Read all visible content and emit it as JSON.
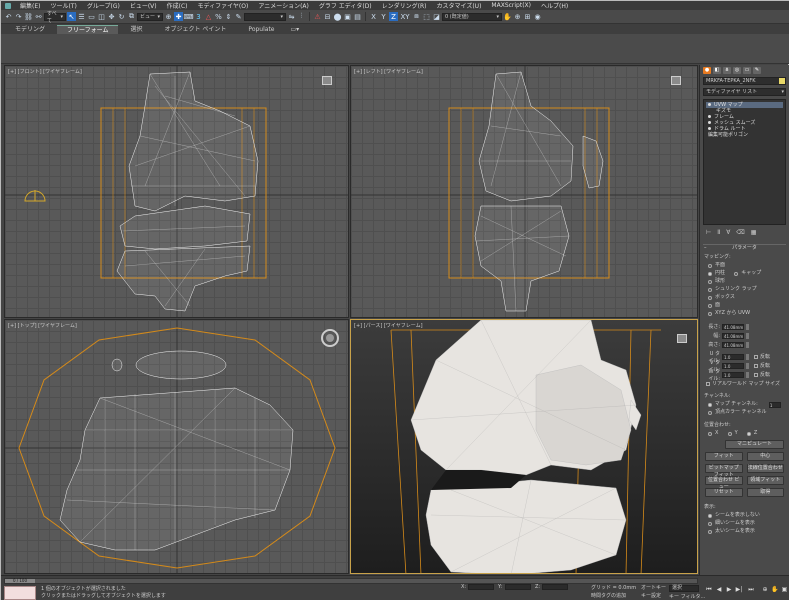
{
  "menu": [
    "編集(E)",
    "ツール(T)",
    "グループ(G)",
    "ビュー(V)",
    "作成(C)",
    "モディファイヤ(O)",
    "アニメーション(A)",
    "グラフ エディタ(D)",
    "レンダリング(R)",
    "カスタマイズ(U)",
    "MAXScript(X)",
    "ヘルプ(H)"
  ],
  "toolbar": {
    "selection_filter": "すべて",
    "ref_coord": "ビュー",
    "named_selection": "",
    "snap_percent": "",
    "axis_x": "X",
    "axis_y": "Y",
    "axis_z": "Z",
    "axis_xy": "XY",
    "layer_select": "0 (既定値)"
  },
  "ribbon": {
    "tabs": [
      "モデリング",
      "フリーフォーム",
      "選択",
      "オブジェクト ペイント",
      "Populate"
    ],
    "active_tab": "フリーフォーム"
  },
  "viewports": {
    "front_label": "[+] [フロント] [ワイヤフレーム]",
    "left_label": "[+] [レフト] [ワイヤフレーム]",
    "top_label": "[+] [トップ] [ワイヤフレーム]",
    "persp_label": "[+] [パース] [ワイヤフレーム]"
  },
  "command_panel": {
    "object_name": "MRKFA-TEPKA_2NFK",
    "modifier_list": "モディファイヤ リスト",
    "stack": [
      "UVW マップ",
      "ギズモ",
      "フレーム",
      "メッシュ スムーズ",
      "ドラム ルート",
      "編集可能ポリゴン"
    ],
    "rollout_title": "パラメータ",
    "mapping_label": "マッピング:",
    "mapping_options": [
      "平面",
      "円柱",
      "球形",
      "シュリンク ラップ",
      "ボックス",
      "面",
      "XYZ から UVW"
    ],
    "cap_label": "キャップ",
    "fields": [
      {
        "label": "長さ:",
        "value": "41.08mm"
      },
      {
        "label": "幅:",
        "value": "41.08mm"
      },
      {
        "label": "高さ:",
        "value": "41.08mm"
      },
      {
        "label": "U タイル:",
        "value": "1.0",
        "flip": "反転"
      },
      {
        "label": "V タイル:",
        "value": "1.0",
        "flip": "反転"
      },
      {
        "label": "W タイル:",
        "value": "1.0",
        "flip": "反転"
      }
    ],
    "real_world_map": "リアルワールド マップ サイズ",
    "channel_label": "チャンネル:",
    "map_channel": "マップ チャンネル:",
    "map_channel_value": "1",
    "vertex_color_channel": "頂点カラー チャンネル",
    "alignment_label": "位置合わせ:",
    "align_axes": [
      "X",
      "Y",
      "Z"
    ],
    "manipulate_btn": "マニピュレート",
    "buttons": [
      [
        "フィット",
        "中心"
      ],
      [
        "ビットマップ フィット",
        "法線位置合わせ"
      ],
      [
        "位置合わせ ビュー",
        "領域フィット"
      ],
      [
        "リセット",
        "取得"
      ]
    ],
    "display_label": "表示:",
    "display_options": [
      "シームを表示しない",
      "細いシームを表示",
      "太いシームを表示"
    ]
  },
  "status": {
    "frame": "0 / 100",
    "msg1": "1 個のオブジェクトが選択されました",
    "msg2": "クリックまたはドラッグしてオブジェクトを選択します",
    "x_label": "X:",
    "y_label": "Y:",
    "z_label": "Z:",
    "grid": "グリッド = 0.0mm",
    "time_tag": "時間タグの追加",
    "autokey": "オートキー",
    "set_key": "キー設定",
    "key_filter": "キー フィルタ...",
    "select_key": "選択"
  }
}
